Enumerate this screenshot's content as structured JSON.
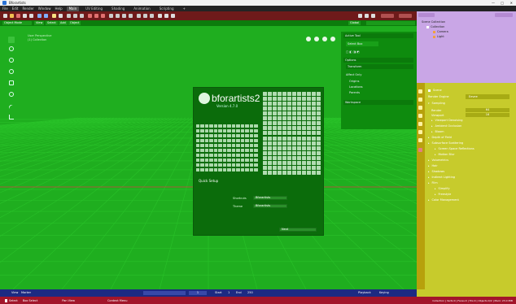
{
  "app": {
    "title": "Bforartists",
    "window_controls": [
      "—",
      "□",
      "✕"
    ]
  },
  "menubar": {
    "items": [
      "File",
      "Edit",
      "Render",
      "Window",
      "Help"
    ],
    "tabs": [
      "Main",
      "UV Editing",
      "Shading",
      "Animation",
      "Scripting",
      "+"
    ],
    "active_tab": "Main"
  },
  "header": {
    "mode": "Object Mode",
    "menus": [
      "View",
      "Select",
      "Add",
      "Object"
    ],
    "orientation": "Global"
  },
  "viewport": {
    "overlay_line1": "User Perspective",
    "overlay_line2": "(1) Collection",
    "bg_color": "#1fae1f"
  },
  "npanel": {
    "active_tool": "Active Tool",
    "tool_name": "Select Box",
    "options": "Options",
    "transform": "Transform",
    "affect_only": "Affect Only",
    "origins": "Origins",
    "locations": "Locations",
    "parents": "Parents",
    "workspace": "Workspace"
  },
  "splash": {
    "brand_left": "bfor",
    "brand_right": "artists2",
    "version": "Version 4.7.0",
    "quick_setup": "Quick Setup",
    "shortcuts_label": "Shortcuts",
    "shortcuts_value": "Bforartists",
    "theme_label": "Theme",
    "theme_value": "Bforartists",
    "next_button": "Next"
  },
  "outliner": {
    "scene_collection": "Scene Collection",
    "collection": "Collection",
    "camera": "Camera",
    "light": "Light"
  },
  "properties": {
    "scene": "Scene",
    "render_engine_label": "Render Engine",
    "render_engine_value": "Eevee",
    "sampling": "Sampling",
    "render": "Render",
    "viewport": "Viewport",
    "render_value": "64",
    "viewport_value": "16",
    "viewport_denoising": "Viewport Denoising",
    "panels": [
      "Ambient Occlusion",
      "Bloom",
      "Depth of Field",
      "Subsurface Scattering",
      "Screen Space Reflections",
      "Motion Blur",
      "Volumetrics",
      "Hair",
      "Shadows",
      "Indirect Lighting",
      "Film",
      "Simplify",
      "Freestyle",
      "Color Management"
    ]
  },
  "timeline": {
    "view": "View",
    "marker": "Marker",
    "start_label": "Start",
    "start_value": "1",
    "end_label": "End",
    "end_value": "250",
    "current_frame": "1",
    "playback": "Playback",
    "keying": "Keying"
  },
  "statusbar": {
    "select": "Select",
    "box_select": "Box Select",
    "pan_view": "Pan View",
    "context_menu": "Context Menu",
    "stats": "Collection | Verts:0 | Faces:0 | Tris:0 | Objects:0/2 | Mem: 23.0 MiB"
  },
  "colors": {
    "toolbar": "#6e1a1a",
    "viewport": "#1fae1f",
    "outliner": "#c9a6e6",
    "properties": "#c7cb2c",
    "timeline": "#1c2a82",
    "statusbar": "#a2152a"
  }
}
